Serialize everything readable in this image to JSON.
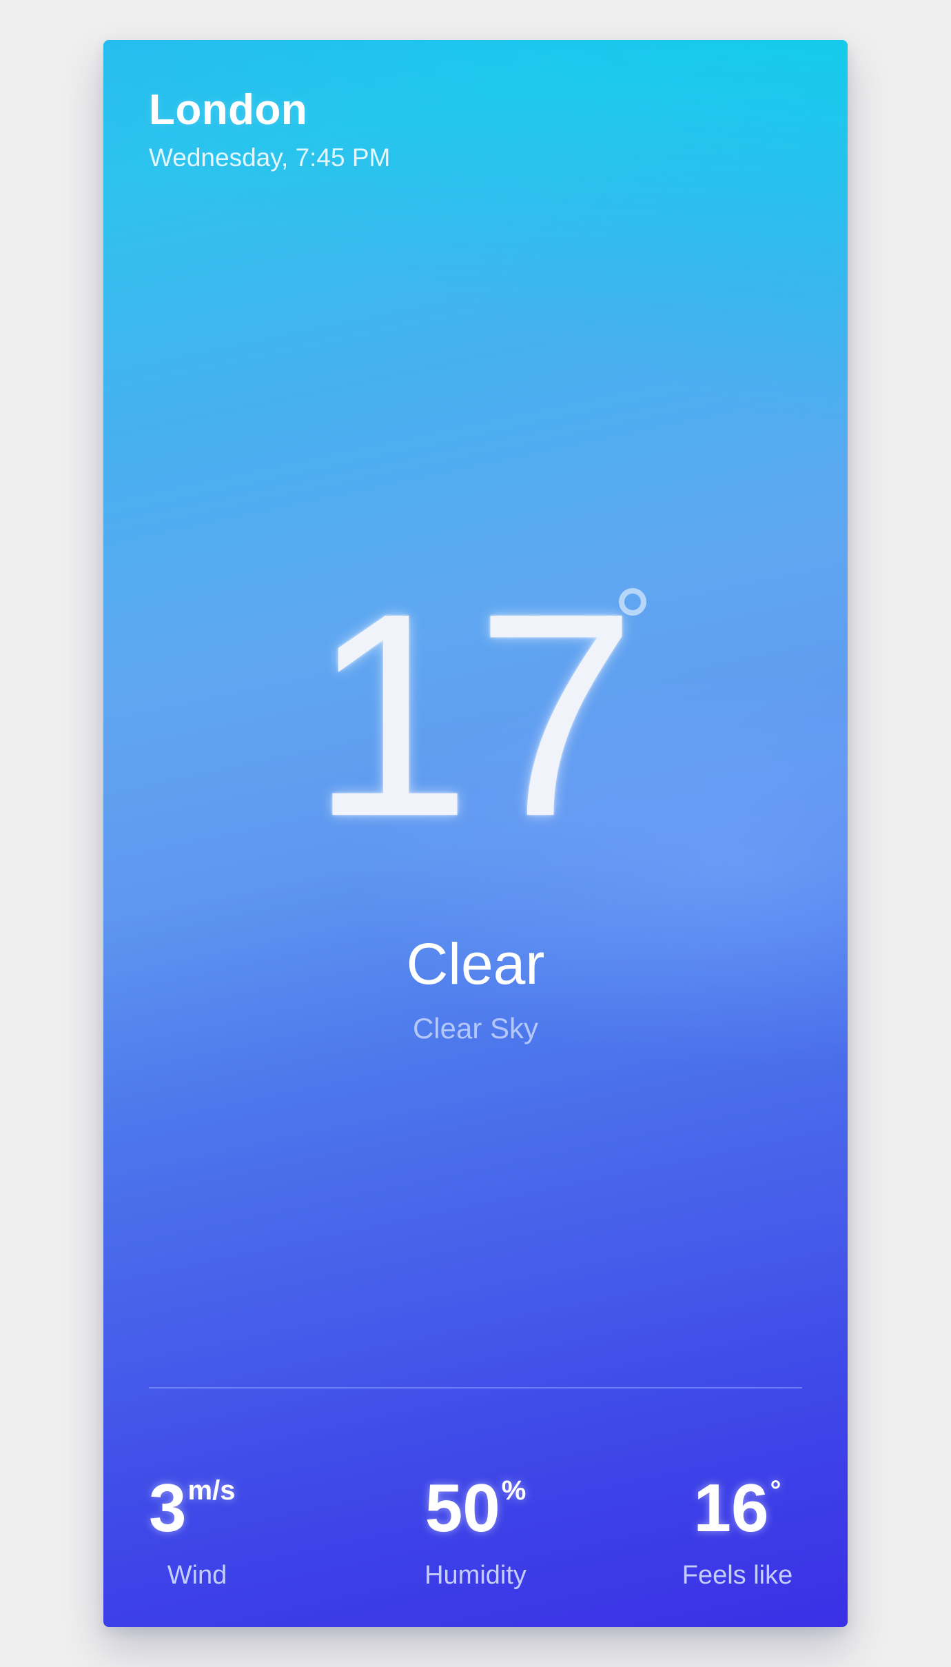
{
  "location": {
    "city": "London",
    "datetime": "Wednesday, 7:45 PM"
  },
  "current": {
    "temperature": "17",
    "degree_symbol": "°",
    "condition": "Clear",
    "description": "Clear Sky"
  },
  "stats": {
    "wind": {
      "value": "3",
      "unit": "m/s",
      "label": "Wind"
    },
    "humidity": {
      "value": "50",
      "unit": "%",
      "label": "Humidity"
    },
    "feels_like": {
      "value": "16",
      "unit": "°",
      "label": "Feels like"
    }
  },
  "colors": {
    "page_background": "#efefef",
    "gradient_top": "#2ec3ee",
    "gradient_middle": "#60a6f1",
    "gradient_bottom": "#3a30e6",
    "text_primary": "#ffffff"
  }
}
